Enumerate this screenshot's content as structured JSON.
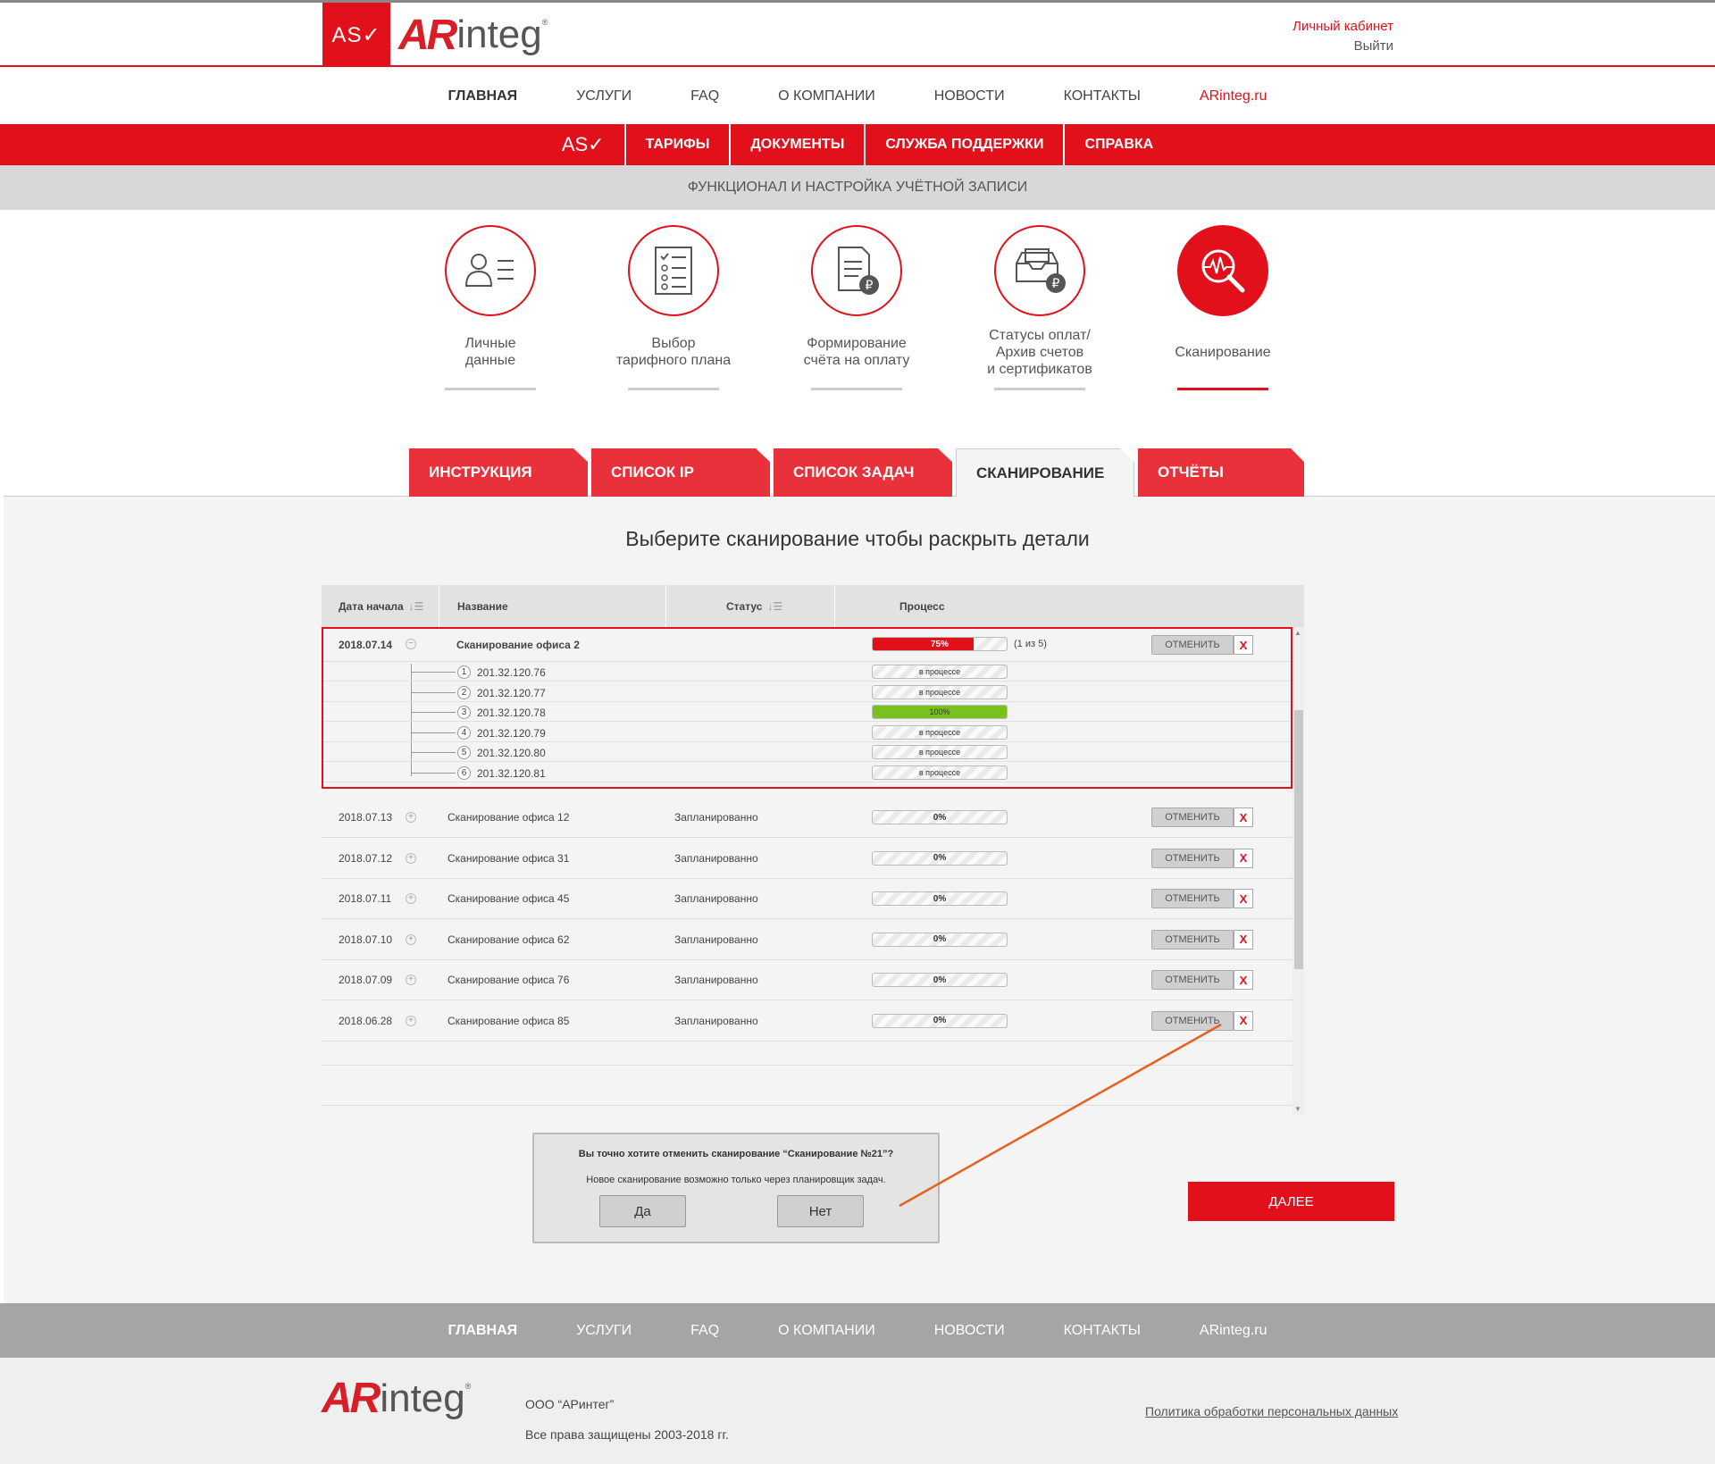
{
  "header": {
    "as_mark": "AS✓",
    "logo_ar": "AR",
    "logo_integ": "integ",
    "logo_reg": "®",
    "account_link": "Личный кабинет",
    "logout_link": "Выйти"
  },
  "main_nav": [
    "ГЛАВНАЯ",
    "УСЛУГИ",
    "FAQ",
    "О КОМПАНИИ",
    "НОВОСТИ",
    "КОНТАКТЫ",
    "ARinteg.ru"
  ],
  "red_nav": {
    "mark": "AS✓",
    "items": [
      "ТАРИФЫ",
      "ДОКУМЕНТЫ",
      "СЛУЖБА ПОДДЕРЖКИ",
      "СПРАВКА"
    ]
  },
  "section_title": "ФУНКЦИОНАЛ И НАСТРОЙКА УЧЁТНОЙ ЗАПИСИ",
  "steps": [
    {
      "label": "Личные\nданные",
      "icon": "person-list-icon"
    },
    {
      "label": "Выбор\nтарифного плана",
      "icon": "checklist-icon"
    },
    {
      "label": "Формирование\nсчёта на оплату",
      "icon": "invoice-ruble-icon"
    },
    {
      "label": "Статусы оплат/\nАрхив счетов\nи сертификатов",
      "icon": "archive-box-icon"
    },
    {
      "label": "Сканирование",
      "icon": "scan-magnifier-icon"
    }
  ],
  "tabs": [
    "ИНСТРУКЦИЯ",
    "СПИСОК IP",
    "СПИСОК ЗАДАЧ",
    "СКАНИРОВАНИЕ",
    "ОТЧЁТЫ"
  ],
  "heading": "Выберите  сканирование чтобы раскрыть детали",
  "table": {
    "headers": {
      "date": "Дата начала",
      "name": "Название",
      "status": "Статус",
      "process": "Процесс"
    },
    "expanded": {
      "date": "2018.07.14",
      "name": "Сканирование офиса 2",
      "progress": 75,
      "progress_label": "75%",
      "count": "(1 из 5)",
      "cancel": "ОТМЕНИТЬ",
      "x": "X",
      "children": [
        {
          "n": "1",
          "ip": "201.32.120.76",
          "state": "в процессе",
          "progress": 0
        },
        {
          "n": "2",
          "ip": "201.32.120.77",
          "state": "в процессе",
          "progress": 0
        },
        {
          "n": "3",
          "ip": "201.32.120.78",
          "state": "100%",
          "progress": 100
        },
        {
          "n": "4",
          "ip": "201.32.120.79",
          "state": "в процессе",
          "progress": 0
        },
        {
          "n": "5",
          "ip": "201.32.120.80",
          "state": "в процессе",
          "progress": 0
        },
        {
          "n": "6",
          "ip": "201.32.120.81",
          "state": "в процессе",
          "progress": 0
        }
      ]
    },
    "rows": [
      {
        "date": "2018.07.13",
        "name": "Сканирование офиса 12",
        "status": "Запланированно",
        "progress": "0%",
        "cancel": "ОТМЕНИТЬ",
        "x": "X"
      },
      {
        "date": "2018.07.12",
        "name": "Сканирование офиса 31",
        "status": "Запланированно",
        "progress": "0%",
        "cancel": "ОТМЕНИТЬ",
        "x": "X"
      },
      {
        "date": "2018.07.11",
        "name": "Сканирование офиса 45",
        "status": "Запланированно",
        "progress": "0%",
        "cancel": "ОТМЕНИТЬ",
        "x": "X"
      },
      {
        "date": "2018.07.10",
        "name": "Сканирование офиса 62",
        "status": "Запланированно",
        "progress": "0%",
        "cancel": "ОТМЕНИТЬ",
        "x": "X"
      },
      {
        "date": "2018.07.09",
        "name": "Сканирование офиса 76",
        "status": "Запланированно",
        "progress": "0%",
        "cancel": "ОТМЕНИТЬ",
        "x": "X"
      },
      {
        "date": "2018.06.28",
        "name": "Сканирование офиса 85",
        "status": "Запланированно",
        "progress": "0%",
        "cancel": "ОТМЕНИТЬ",
        "x": "X"
      }
    ]
  },
  "dialog": {
    "question": "Вы точно хотите отменить сканирование “Сканирование №21”?",
    "note": "Новое сканирование возможно только через  планировщик задач.",
    "yes": "Да",
    "no": "Нет"
  },
  "next_button": "ДАЛЕЕ",
  "footer_nav": [
    "ГЛАВНАЯ",
    "УСЛУГИ",
    "FAQ",
    "О КОМПАНИИ",
    "НОВОСТИ",
    "КОНТАКТЫ",
    "ARinteg.ru"
  ],
  "footer": {
    "company": "ООО “АРинтег”",
    "rights": "Все права защищены 2003-2018 гг.",
    "policy_link": "Политика обработки персональных данных"
  },
  "colors": {
    "accent": "#e2101a",
    "success": "#79c11f",
    "gray": "#a5a5a5"
  }
}
